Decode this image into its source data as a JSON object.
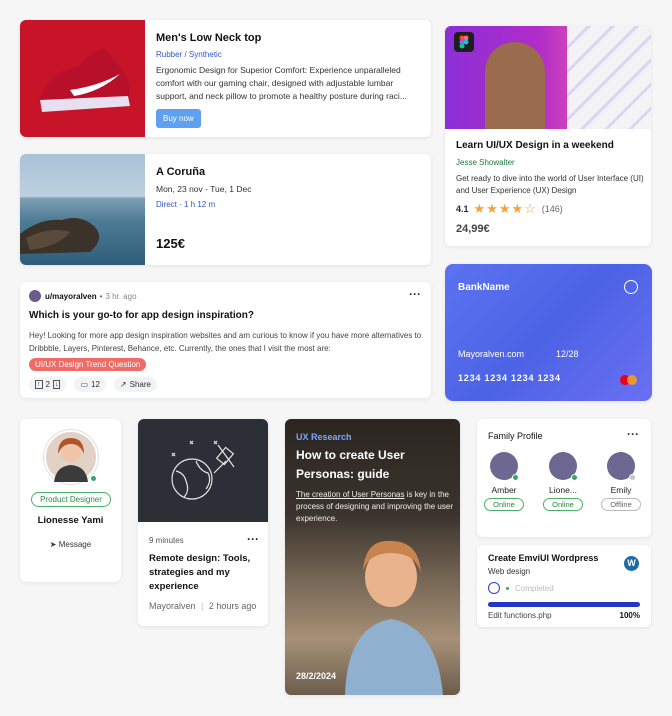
{
  "product": {
    "title": "Men's Low Neck top",
    "material": "Rubber / Synthetic",
    "description": "Ergonomic Design for Superior Comfort: Experience unparalleled comfort with our gaming chair, designed with adjustable lumbar support, and neck pillow to promote a healthy posture during raci...",
    "buy_label": "Buy now"
  },
  "flight": {
    "city": "A Coruña",
    "dates": "Mon, 23 nov - Tue, 1 Dec",
    "direct": "Direct · 1 h 12 m",
    "price": "125€"
  },
  "course": {
    "title": "Learn UI/UX Design in a weekend",
    "author": "Jesse Showalter",
    "description": "Get ready to dive into the world of User Interface (UI) and User Experience (UX) Design",
    "rating": "4.1",
    "stars": 4,
    "reviews": "(146)",
    "price": "24,99€"
  },
  "post": {
    "user": "u/mayoralven",
    "time": "3 hr. ago",
    "title": "Which is your go-to for app design inspiration?",
    "body": "Hey! Looking for more app design inspiration websites and am curious to know if you have more alternatives to Dribbble, Layers, Pinterest, Behance, etc. Currently, the ones that I visit the most are:",
    "tag": "UI/UX Design Trend Question",
    "votes": "2",
    "comments": "12",
    "share_label": "Share"
  },
  "bank": {
    "name": "BankName",
    "holder": "Mayoralven.com",
    "expiry": "12/28",
    "number": "1234 1234 1234 1234"
  },
  "profile": {
    "role": "Product Designer",
    "name": "Lionesse Yami",
    "message_label": "Message"
  },
  "remote": {
    "minutes": "9 minutes",
    "title": "Remote design: Tools, strategies and my experience",
    "author": "Mayoralven",
    "time": "2 hours ago"
  },
  "ux": {
    "kicker": "UX Research",
    "title": "How to create User Personas: guide",
    "description_link": "The creation of User Personas",
    "description_rest": " is key in the process of designing and improving the user experience.",
    "date": "28/2/2024"
  },
  "family": {
    "title": "Family Profile",
    "members": [
      {
        "name": "Amber",
        "status": "Online"
      },
      {
        "name": "Lione...",
        "status": "Online"
      },
      {
        "name": "Emily",
        "status": "Offline"
      }
    ]
  },
  "task": {
    "title": "Create EmviUI Wordpress",
    "subtitle": "Web design",
    "status": "Completed",
    "file": "Edit functions.php",
    "progress": "100%"
  },
  "colors": {
    "link_blue": "#2f55d4",
    "online_green": "#27ae60",
    "tag_red": "#f06b65",
    "bank_purple": "#5b73f0",
    "progress_blue": "#2536c6"
  }
}
